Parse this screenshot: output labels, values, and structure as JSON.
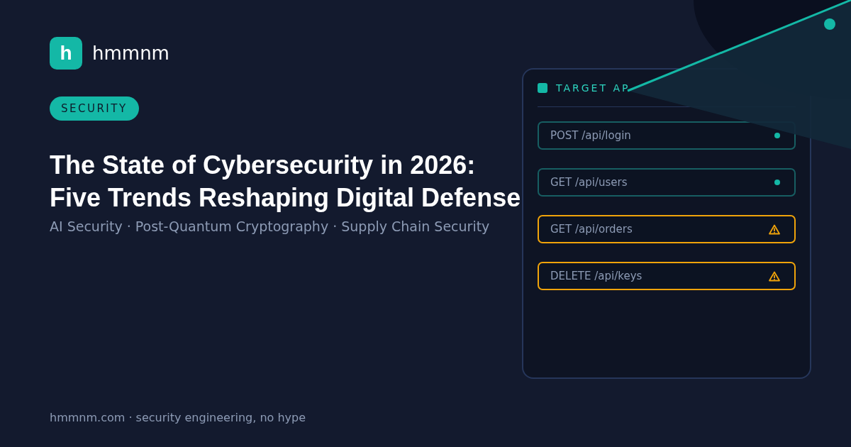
{
  "brand": {
    "logo_letter": "h",
    "name": "hmmnm"
  },
  "category": "SECURITY",
  "title_lines": [
    "The State of Cybersecurity in 2026:",
    "Five Trends Reshaping Digital Defense"
  ],
  "subtitle": "AI Security · Post-Quantum Cryptography · Supply Chain Security",
  "footer": "hmmnm.com · security engineering, no hype",
  "panel": {
    "title": "TARGET AP",
    "endpoints": [
      {
        "label": "POST /api/login",
        "kind": "ok"
      },
      {
        "label": "GET /api/users",
        "kind": "ok"
      },
      {
        "label": "GET /api/orders",
        "kind": "warning"
      },
      {
        "label": "DELETE /api/keys",
        "kind": "warning"
      }
    ]
  }
}
